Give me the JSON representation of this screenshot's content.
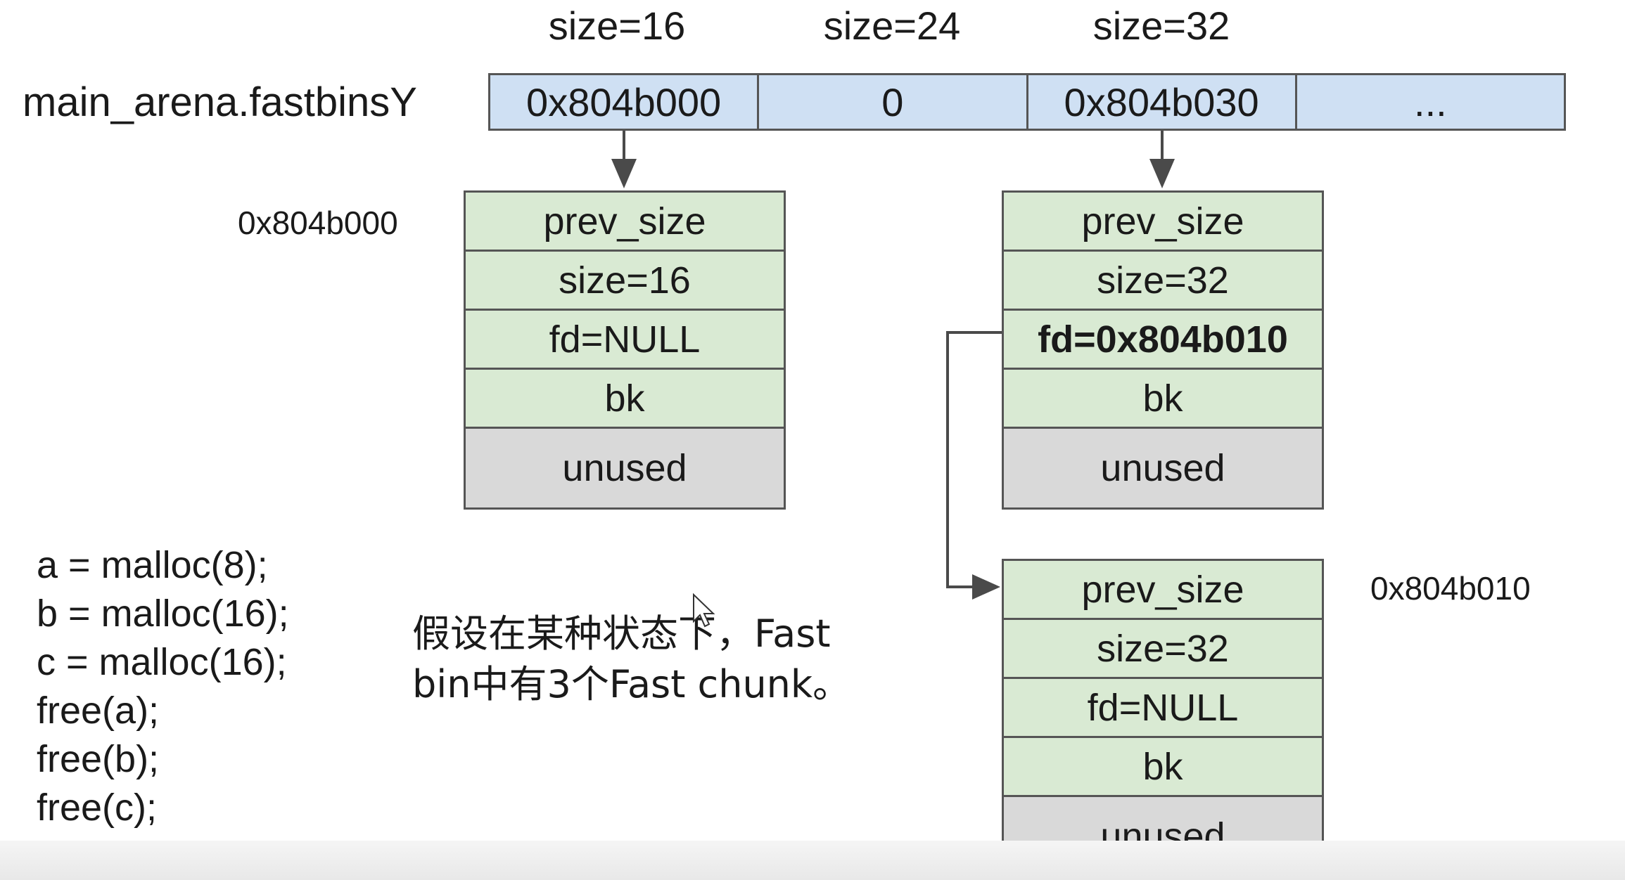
{
  "size_labels": [
    "size=16",
    "size=24",
    "size=32"
  ],
  "arena_label": "main_arena.fastbinsY",
  "bins": [
    "0x804b000",
    "0",
    "0x804b030",
    "..."
  ],
  "chunks": [
    {
      "address": "0x804b000",
      "fields": [
        "prev_size",
        "size=16",
        "fd=NULL",
        "bk",
        "unused"
      ],
      "bold_field_index": -1
    },
    {
      "address": "",
      "fields": [
        "prev_size",
        "size=32",
        "fd=0x804b010",
        "bk",
        "unused"
      ],
      "bold_field_index": 2
    },
    {
      "address": "0x804b010",
      "fields": [
        "prev_size",
        "size=32",
        "fd=NULL",
        "bk",
        "unused"
      ],
      "bold_field_index": -1
    }
  ],
  "code_lines": [
    "a = malloc(8);",
    "b = malloc(16);",
    "c = malloc(16);",
    "free(a);",
    "free(b);",
    "free(c);"
  ],
  "note": [
    "假设在某种状态下，Fast",
    "bin中有3个Fast chunk。"
  ],
  "colors": {
    "bin_fill": "#cfe0f3",
    "field_fill": "#d9ead3",
    "unused_fill": "#d9d9d9",
    "border": "#555555",
    "arrow": "#4a4a4a"
  }
}
